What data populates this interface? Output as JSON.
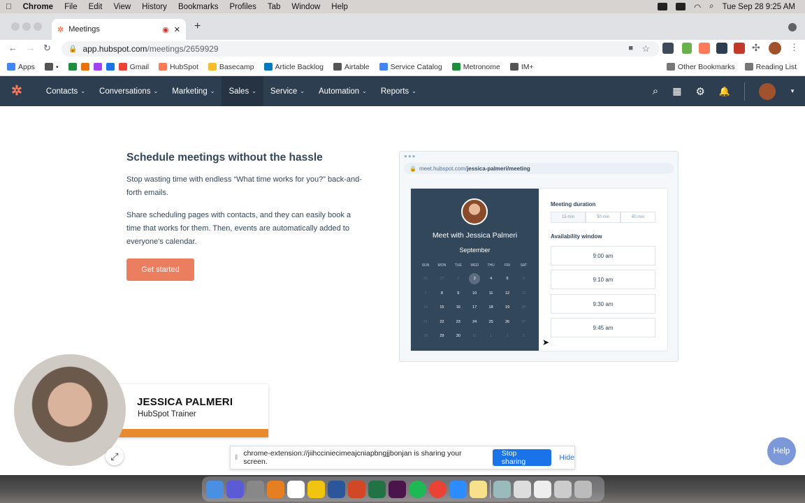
{
  "menubar": {
    "app": "Chrome",
    "items": [
      "File",
      "Edit",
      "View",
      "History",
      "Bookmarks",
      "Profiles",
      "Tab",
      "Window",
      "Help"
    ],
    "clock": "Tue Sep 28  9:25 AM"
  },
  "browser": {
    "tab_title": "Meetings",
    "url_host": "app.hubspot.com",
    "url_path": "/meetings/2659929",
    "bookmarks": [
      {
        "label": "Apps",
        "color": "#4285f4"
      },
      {
        "label": "•",
        "color": "#555"
      },
      {
        "label": "",
        "color": "#1e8e3e"
      },
      {
        "label": "",
        "color": "#e8710a"
      },
      {
        "label": "",
        "color": "#a142f4"
      },
      {
        "label": "",
        "color": "#1a73e8"
      },
      {
        "label": "Gmail",
        "color": "#ea4335"
      },
      {
        "label": "HubSpot",
        "color": "#ff7a59"
      },
      {
        "label": "Basecamp",
        "color": "#f9bc2c"
      },
      {
        "label": "Article Backlog",
        "color": "#0079bf"
      },
      {
        "label": "Airtable",
        "color": "#555"
      },
      {
        "label": "Service Catalog",
        "color": "#4285f4"
      },
      {
        "label": "Metronome",
        "color": "#1e8e3e"
      },
      {
        "label": "IM+",
        "color": "#555"
      }
    ],
    "other_bookmarks": "Other Bookmarks",
    "reading_list": "Reading List"
  },
  "hubspot_nav": {
    "items": [
      {
        "label": "Contacts",
        "active": false
      },
      {
        "label": "Conversations",
        "active": false
      },
      {
        "label": "Marketing",
        "active": false
      },
      {
        "label": "Sales",
        "active": true
      },
      {
        "label": "Service",
        "active": false
      },
      {
        "label": "Automation",
        "active": false
      },
      {
        "label": "Reports",
        "active": false
      }
    ]
  },
  "main": {
    "heading": "Schedule meetings without the hassle",
    "para1": "Stop wasting time with endless “What time works for you?” back-and-forth emails.",
    "para2": "Share scheduling pages with contacts, and they can easily book a time that works for them. Then, events are automatically added to everyone's calendar.",
    "cta": "Get started"
  },
  "preview": {
    "url_prefix": "meet.hubspot.com/",
    "url_bold": "jessica-palmeri/meeting",
    "meet_with": "Meet with Jessica Palmeri",
    "month": "September",
    "weekdays": [
      "SUN",
      "MON",
      "TUE",
      "WED",
      "THU",
      "FRI",
      "SAT"
    ],
    "weeks": [
      [
        "26",
        "27",
        "2",
        "3",
        "4",
        "5",
        "6"
      ],
      [
        "7",
        "8",
        "9",
        "10",
        "11",
        "12",
        "13"
      ],
      [
        "14",
        "15",
        "16",
        "17",
        "18",
        "19",
        "20"
      ],
      [
        "21",
        "22",
        "23",
        "24",
        "25",
        "26",
        "27"
      ],
      [
        "28",
        "29",
        "30",
        "31",
        "1",
        "2",
        "3"
      ]
    ],
    "selected_day": "3",
    "duration_label": "Meeting duration",
    "durations": [
      "15 min",
      "30 min",
      "60 min"
    ],
    "availability_label": "Availability window",
    "slots": [
      "9:00 am",
      "9:10 am",
      "9:30 am",
      "9:45 am"
    ]
  },
  "presenter": {
    "name": "JESSICA PALMERI",
    "role": "HubSpot Trainer"
  },
  "sharing": {
    "message": "chrome-extension://jiihcciniecimeajcniapbngjjbonjan is sharing your screen.",
    "stop": "Stop sharing",
    "hide": "Hide"
  },
  "help": "Help"
}
